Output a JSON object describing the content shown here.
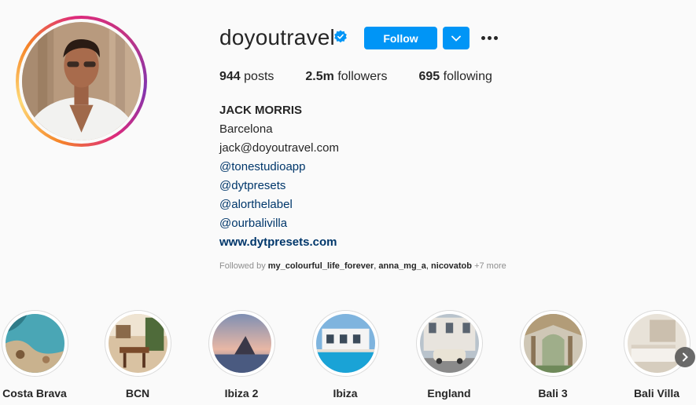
{
  "profile": {
    "username": "doyoutravel",
    "verified_icon": "verified-badge-icon",
    "follow_label": "Follow",
    "dropdown_icon": "chevron-down-icon",
    "more_icon": "more-options-icon",
    "accent_color": "#0095f6"
  },
  "stats": {
    "posts_count": "944",
    "posts_label": "posts",
    "followers_count": "2.5m",
    "followers_label": "followers",
    "following_count": "695",
    "following_label": "following"
  },
  "bio": {
    "name": "JACK MORRIS",
    "location": "Barcelona",
    "email": "jack@doyoutravel.com",
    "tags": [
      "@tonestudioapp",
      "@dytpresets",
      "@alorthelabel",
      "@ourbalivilla"
    ],
    "website": "www.dytpresets.com"
  },
  "followed_by": {
    "prefix": "Followed by",
    "users": [
      "my_colourful_life_forever",
      "anna_mg_a",
      "nicovatob"
    ],
    "more": "+7 more"
  },
  "highlights": [
    {
      "label": "Costa Brava"
    },
    {
      "label": "BCN"
    },
    {
      "label": "Ibiza 2"
    },
    {
      "label": "Ibiza"
    },
    {
      "label": "England"
    },
    {
      "label": "Bali 3"
    },
    {
      "label": "Bali Villa"
    }
  ],
  "next_icon": "chevron-right-icon"
}
